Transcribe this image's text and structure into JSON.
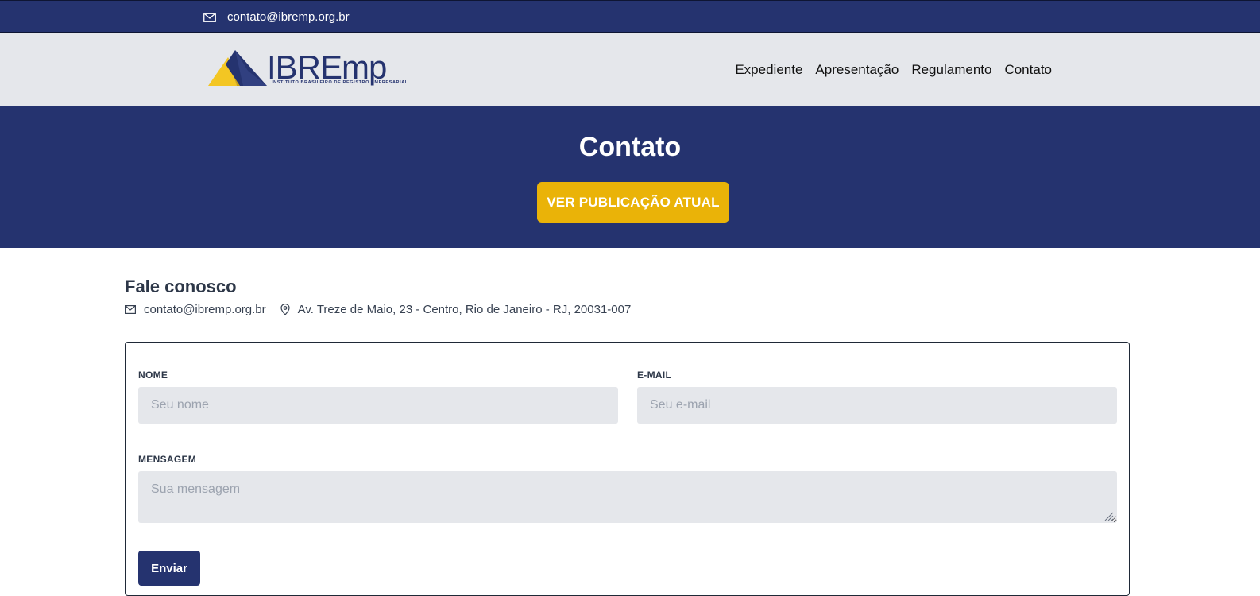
{
  "topbar": {
    "email": "contato@ibremp.org.br",
    "icon": "mail-icon"
  },
  "header": {
    "logo": {
      "name": "IBREmp",
      "tagline": "INSTITUTO BRASILEIRO DE REGISTRO EMPRESARIAL"
    },
    "nav": [
      {
        "label": "Expediente"
      },
      {
        "label": "Apresentação"
      },
      {
        "label": "Regulamento"
      },
      {
        "label": "Contato"
      }
    ]
  },
  "hero": {
    "title": "Contato",
    "button_label": "VER PUBLICAÇÃO ATUAL"
  },
  "contact": {
    "title": "Fale conosco",
    "email": "contato@ibremp.org.br",
    "address": "Av. Treze de Maio, 23 - Centro, Rio de Janeiro - RJ, 20031-007"
  },
  "form": {
    "name_label": "NOME",
    "name_placeholder": "Seu nome",
    "email_label": "E-MAIL",
    "email_placeholder": "Seu e-mail",
    "message_label": "MENSAGEM",
    "message_placeholder": "Sua mensagem",
    "submit_label": "Enviar"
  },
  "colors": {
    "primary": "#25336f",
    "accent": "#eab308",
    "header_bg": "#e5e7eb",
    "field_bg": "#e5e7eb"
  }
}
